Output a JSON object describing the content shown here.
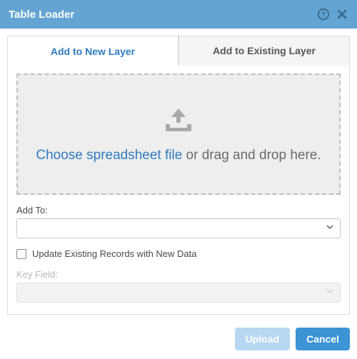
{
  "title": "Table Loader",
  "tabs": {
    "new_layer": "Add to New Layer",
    "existing_layer": "Add to Existing Layer"
  },
  "dropzone": {
    "link_text": "Choose spreadsheet file",
    "rest_text": " or drag and drop here."
  },
  "fields": {
    "add_to_label": "Add To:",
    "add_to_value": "",
    "update_existing_label": "Update Existing Records with New Data",
    "update_existing_checked": false,
    "key_field_label": "Key Field:",
    "key_field_value": ""
  },
  "buttons": {
    "upload": "Upload",
    "cancel": "Cancel"
  }
}
